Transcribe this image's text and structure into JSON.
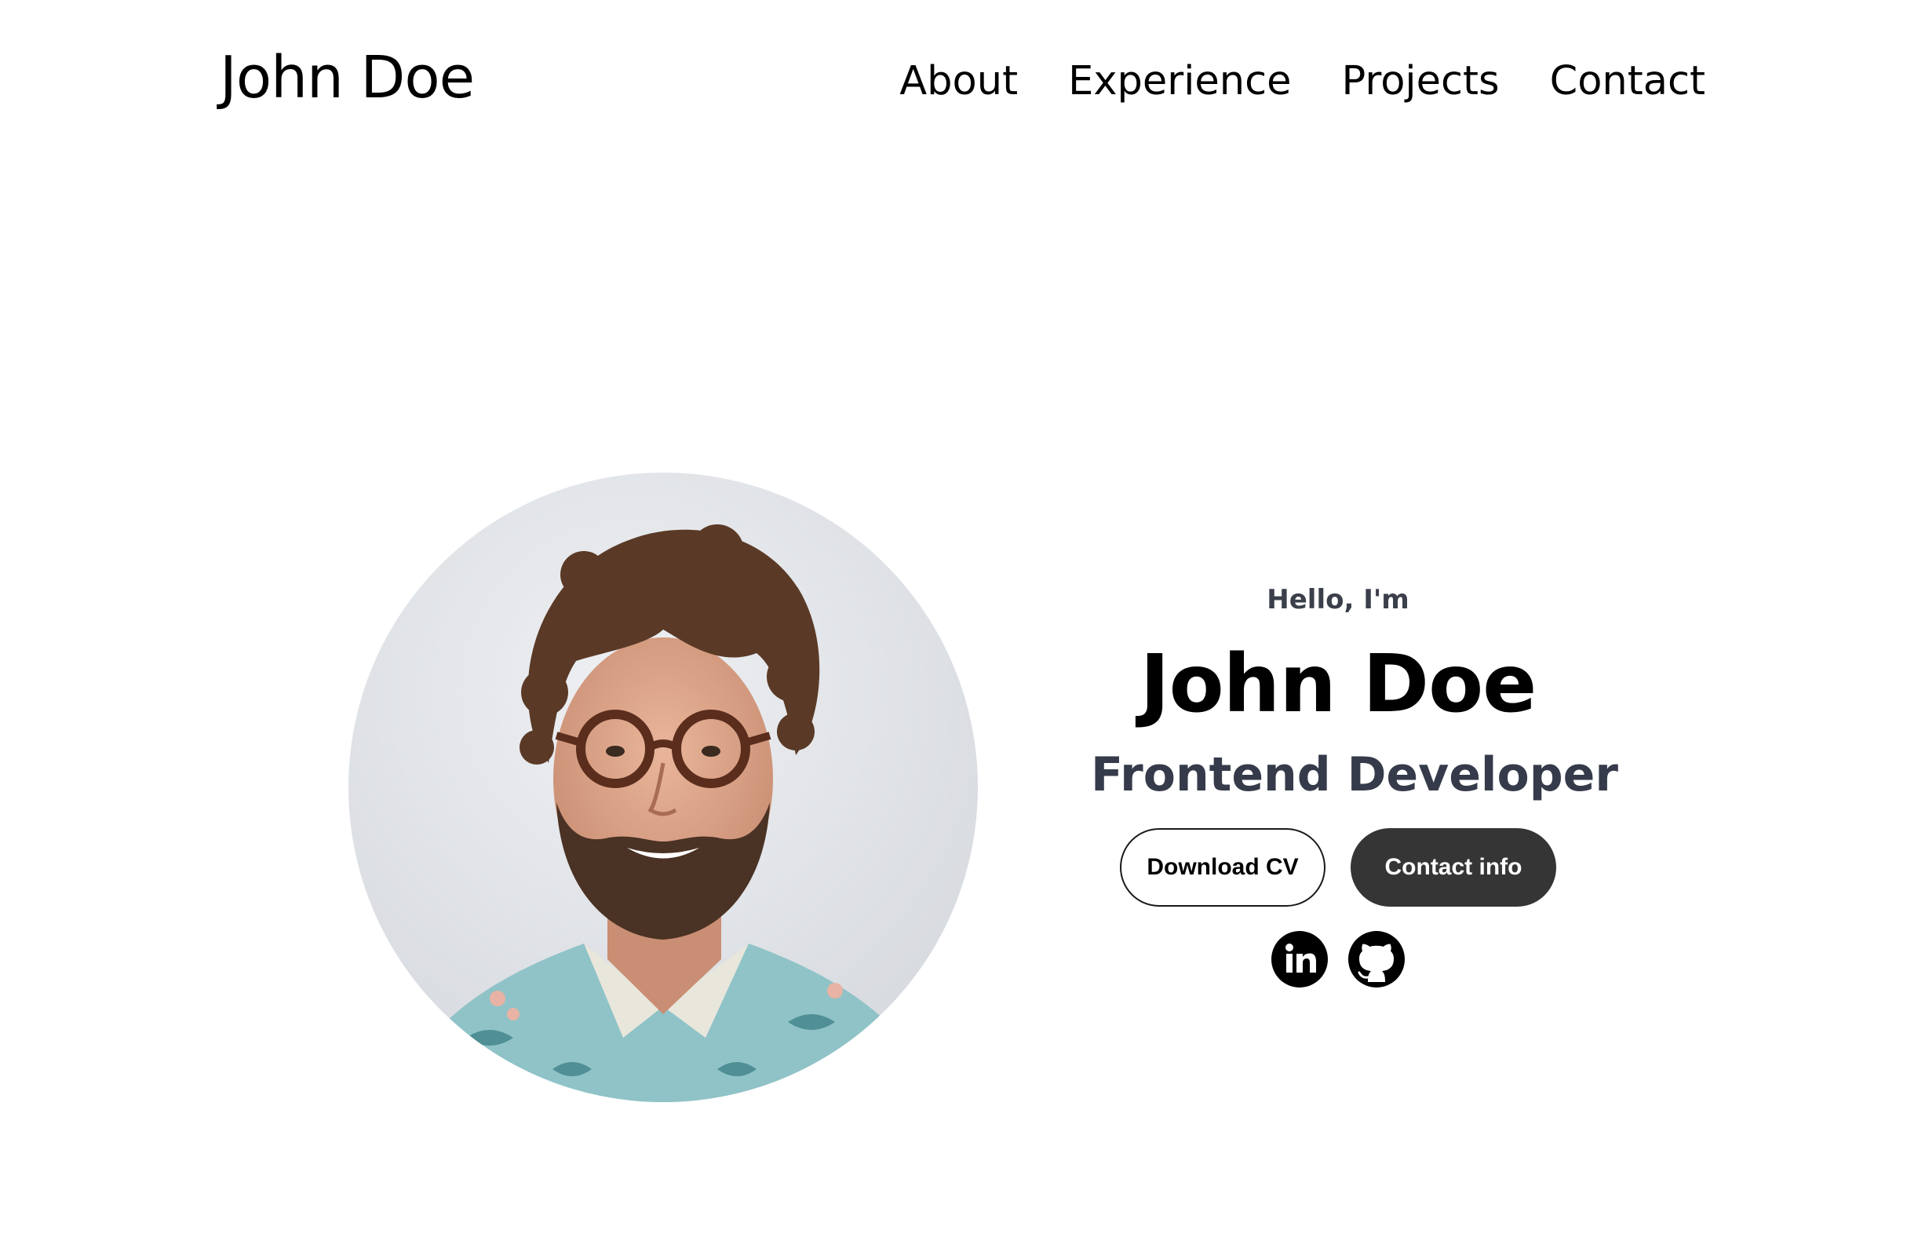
{
  "header": {
    "logo": "John Doe",
    "nav": [
      {
        "label": "About"
      },
      {
        "label": "Experience"
      },
      {
        "label": "Projects"
      },
      {
        "label": "Contact"
      }
    ]
  },
  "hero": {
    "greeting": "Hello, I'm",
    "name": "John Doe",
    "role": "Frontend Developer",
    "buttons": {
      "download_cv": "Download CV",
      "contact_info": "Contact info"
    },
    "socials": [
      {
        "icon": "linkedin-icon"
      },
      {
        "icon": "github-icon"
      }
    ],
    "profile_picture_alt": "profile picture"
  },
  "colors": {
    "text": "#000000",
    "subtitle": "#353b4a",
    "button_dark": "#353535",
    "background": "#ffffff"
  }
}
